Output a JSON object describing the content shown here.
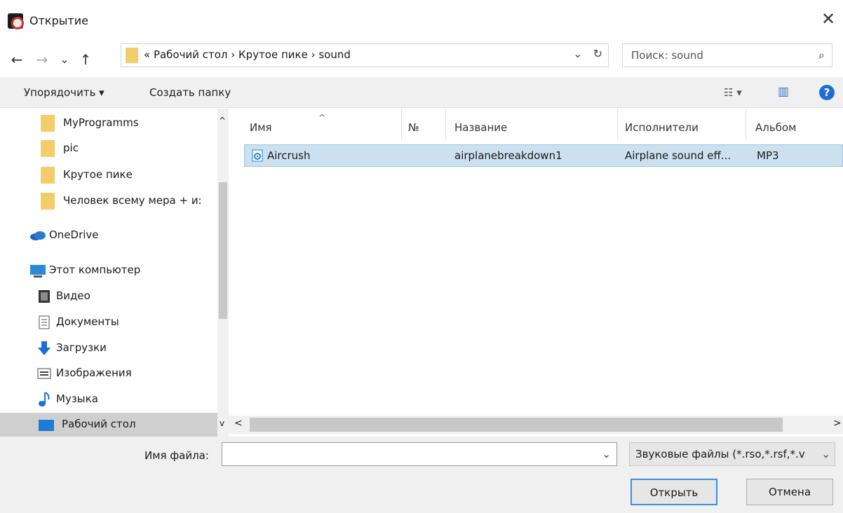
{
  "window": {
    "title": "Открытие",
    "close": "✕"
  },
  "nav": {
    "back": "←",
    "forward": "→",
    "recent": "⌄",
    "up": "↑"
  },
  "address": {
    "path": "« Рабочий стол › Крутое пике › sound",
    "dropdown": "⌄",
    "refresh": "↻"
  },
  "search": {
    "placeholder": "Поиск: sound",
    "icon": "⌕"
  },
  "toolbar": {
    "organize": "Упорядочить ▾",
    "new_folder": "Создать папку",
    "view": "☷ ▾",
    "pane": "▥",
    "help": "?"
  },
  "sidebar": {
    "items": [
      {
        "label": "MyProgramms",
        "icon": "folder-icon"
      },
      {
        "label": "pic",
        "icon": "folder-icon"
      },
      {
        "label": "Крутое пике",
        "icon": "folder-icon"
      },
      {
        "label": "Человек всему мера + и:",
        "icon": "folder-icon"
      },
      {
        "label": "OneDrive",
        "icon": "onedrive-icon"
      },
      {
        "label": "Этот компьютер",
        "icon": "computer-icon"
      },
      {
        "label": "Видео",
        "icon": "video-icon"
      },
      {
        "label": "Документы",
        "icon": "documents-icon"
      },
      {
        "label": "Загрузки",
        "icon": "downloads-icon"
      },
      {
        "label": "Изображения",
        "icon": "pictures-icon"
      },
      {
        "label": "Музыка",
        "icon": "music-icon"
      },
      {
        "label": "Рабочий стол",
        "icon": "desktop-icon"
      }
    ],
    "scroll_up": "^",
    "scroll_down": "v"
  },
  "columns": [
    "Имя",
    "№",
    "Название",
    "Исполнители",
    "Альбом"
  ],
  "sort_indicator": "^",
  "files": [
    {
      "name": "Aircrush",
      "number": "",
      "title": "airplanebreakdown1",
      "artists": "Airplane sound eff...",
      "album": "MP3"
    }
  ],
  "hscroll": {
    "left": "<",
    "right": ">"
  },
  "bottom": {
    "filename_label": "Имя файла:",
    "filename_value": "",
    "filename_dropdown": "⌄",
    "filter": "Звуковые файлы (*.rso,*.rsf,*.v",
    "filter_dropdown": "⌄",
    "open": "Открыть",
    "cancel": "Отмена"
  }
}
